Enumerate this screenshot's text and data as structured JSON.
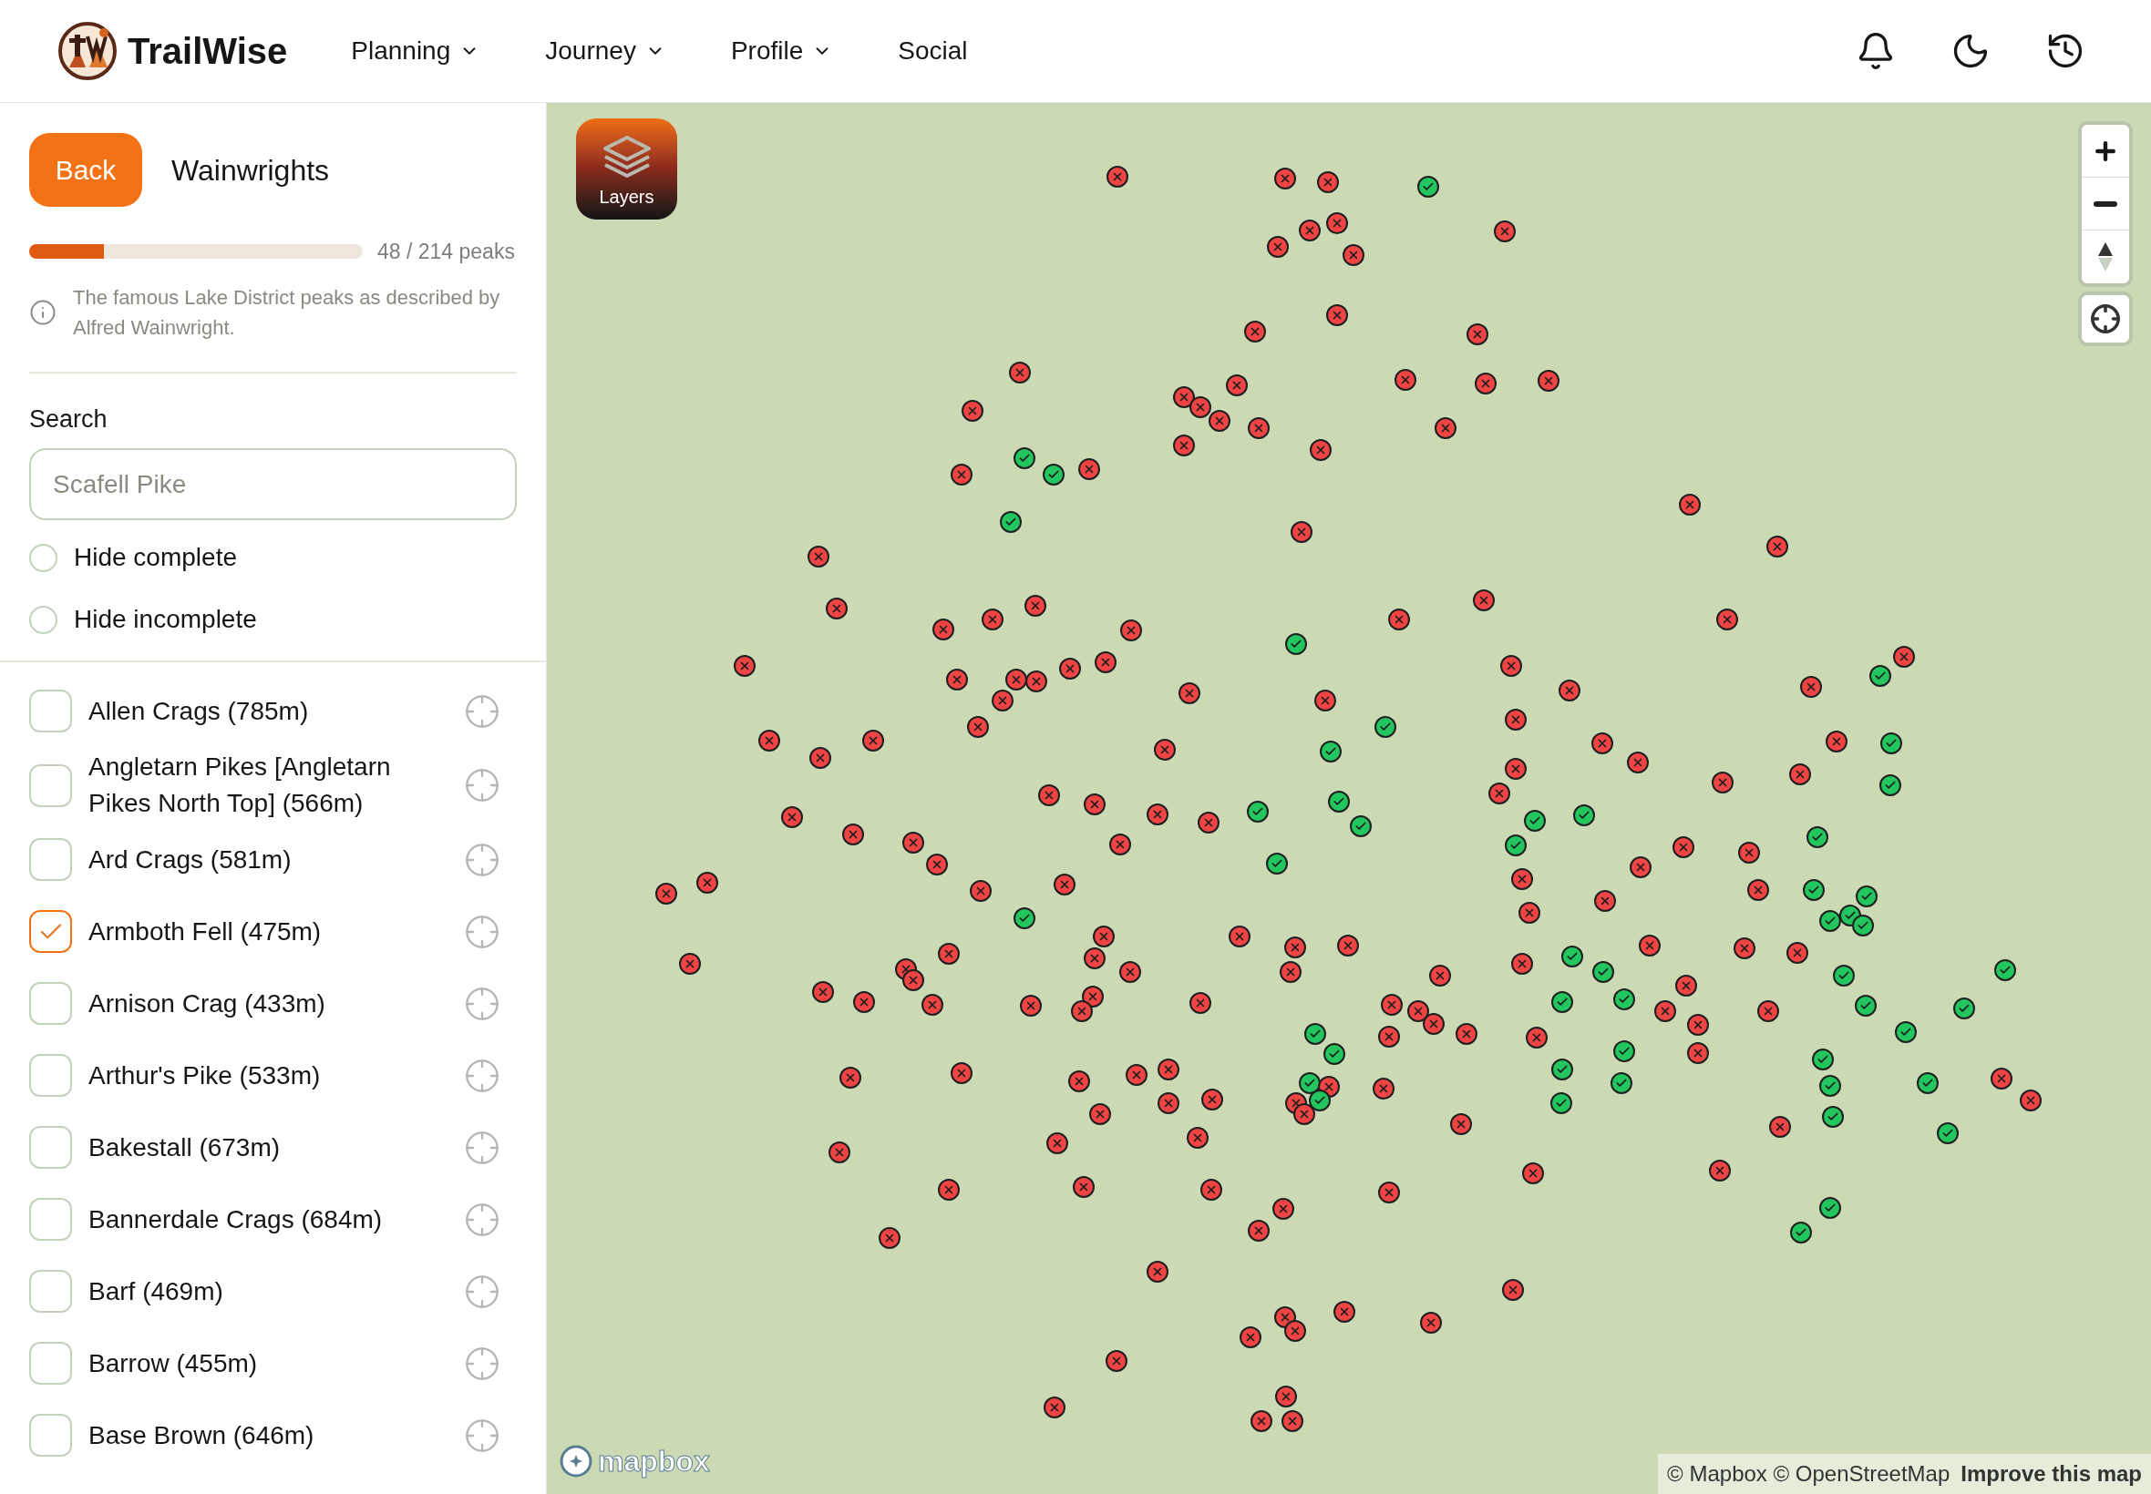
{
  "header": {
    "brand": "TrailWise",
    "nav": [
      {
        "label": "Planning",
        "dropdown": true
      },
      {
        "label": "Journey",
        "dropdown": true
      },
      {
        "label": "Profile",
        "dropdown": true
      },
      {
        "label": "Social",
        "dropdown": false
      }
    ]
  },
  "sidebar": {
    "back_button": "Back",
    "title": "Wainwrights",
    "progress": {
      "level": 0.224,
      "reading": "48 / 214 peaks"
    },
    "description": "The famous Lake District peaks as described by Alfred Wainwright.",
    "search": {
      "label": "Search",
      "placeholder": "Scafell Pike"
    },
    "filters": [
      {
        "label": "Hide complete",
        "selected": false
      },
      {
        "label": "Hide incomplete",
        "selected": false
      }
    ],
    "peaks": [
      {
        "label": "Allen Crags (785m)",
        "checked": false
      },
      {
        "label": "Angletarn Pikes [Angletarn Pikes North Top] (566m)",
        "checked": false
      },
      {
        "label": "Ard Crags (581m)",
        "checked": false
      },
      {
        "label": "Armboth Fell (475m)",
        "checked": true
      },
      {
        "label": "Arnison Crag (433m)",
        "checked": false
      },
      {
        "label": "Arthur's Pike (533m)",
        "checked": false
      },
      {
        "label": "Bakestall (673m)",
        "checked": false
      },
      {
        "label": "Bannerdale Crags (684m)",
        "checked": false
      },
      {
        "label": "Barf (469m)",
        "checked": false
      },
      {
        "label": "Barrow (455m)",
        "checked": false
      },
      {
        "label": "Base Brown (646m)",
        "checked": false
      }
    ]
  },
  "map": {
    "layers_button": "Layers",
    "logo": "mapbox",
    "attribution": "© Mapbox © OpenStreetMap",
    "improve_link": "Improve this map",
    "markers": [
      {
        "complete": false
      },
      {
        "complete": false
      },
      {
        "complete": false
      },
      {
        "complete": true
      },
      {
        "complete": false
      },
      {
        "complete": false
      },
      {
        "complete": false
      },
      {
        "complete": false
      },
      {
        "complete": false
      },
      {
        "complete": false
      },
      {
        "complete": false
      },
      {
        "complete": false
      },
      {
        "complete": false
      },
      {
        "complete": false
      },
      {
        "complete": false
      },
      {
        "complete": false
      },
      {
        "complete": false
      },
      {
        "complete": false
      },
      {
        "complete": false
      },
      {
        "complete": false
      },
      {
        "complete": false
      },
      {
        "complete": false
      },
      {
        "complete": false
      },
      {
        "complete": false
      },
      {
        "complete": false
      },
      {
        "complete": true
      },
      {
        "complete": true
      },
      {
        "complete": false
      },
      {
        "complete": false
      },
      {
        "complete": true
      },
      {
        "complete": false
      },
      {
        "complete": false
      },
      {
        "complete": false
      },
      {
        "complete": false
      },
      {
        "complete": false
      },
      {
        "complete": false
      },
      {
        "complete": false
      },
      {
        "complete": false
      },
      {
        "complete": false
      },
      {
        "complete": true
      },
      {
        "complete": false
      },
      {
        "complete": false
      },
      {
        "complete": false
      },
      {
        "complete": false
      },
      {
        "complete": true
      },
      {
        "complete": false
      },
      {
        "complete": false
      },
      {
        "complete": false
      },
      {
        "complete": false
      },
      {
        "complete": false
      },
      {
        "complete": false
      },
      {
        "complete": false
      },
      {
        "complete": false
      },
      {
        "complete": false
      },
      {
        "complete": false
      },
      {
        "complete": false
      },
      {
        "complete": false
      },
      {
        "complete": true
      },
      {
        "complete": false
      },
      {
        "complete": false
      },
      {
        "complete": false
      },
      {
        "complete": false
      },
      {
        "complete": false
      },
      {
        "complete": false
      },
      {
        "complete": true
      },
      {
        "complete": false
      },
      {
        "complete": false
      },
      {
        "complete": true
      },
      {
        "complete": false
      },
      {
        "complete": false
      },
      {
        "complete": false
      },
      {
        "complete": false
      },
      {
        "complete": false
      },
      {
        "complete": false
      },
      {
        "complete": false
      },
      {
        "complete": true
      },
      {
        "complete": true
      },
      {
        "complete": true
      },
      {
        "complete": true
      },
      {
        "complete": true
      },
      {
        "complete": true
      },
      {
        "complete": false
      },
      {
        "complete": false
      },
      {
        "complete": true
      },
      {
        "complete": false
      },
      {
        "complete": false
      },
      {
        "complete": false
      },
      {
        "complete": false
      },
      {
        "complete": false
      },
      {
        "complete": false
      },
      {
        "complete": false
      },
      {
        "complete": false
      },
      {
        "complete": true
      },
      {
        "complete": true
      },
      {
        "complete": false
      },
      {
        "complete": false
      },
      {
        "complete": false
      },
      {
        "complete": false
      },
      {
        "complete": false
      },
      {
        "complete": false
      },
      {
        "complete": false
      },
      {
        "complete": false
      },
      {
        "complete": true
      },
      {
        "complete": true
      },
      {
        "complete": true
      },
      {
        "complete": true
      },
      {
        "complete": true
      },
      {
        "complete": true
      },
      {
        "complete": false
      },
      {
        "complete": false
      },
      {
        "complete": false
      },
      {
        "complete": false
      },
      {
        "complete": false
      },
      {
        "complete": false
      },
      {
        "complete": false
      },
      {
        "complete": false
      },
      {
        "complete": false
      },
      {
        "complete": false
      },
      {
        "complete": false
      },
      {
        "complete": true
      },
      {
        "complete": true
      },
      {
        "complete": false
      },
      {
        "complete": false
      },
      {
        "complete": false
      },
      {
        "complete": false
      },
      {
        "complete": true
      },
      {
        "complete": true
      },
      {
        "complete": false
      },
      {
        "complete": false
      },
      {
        "complete": false
      },
      {
        "complete": false
      },
      {
        "complete": false
      },
      {
        "complete": false
      },
      {
        "complete": false
      },
      {
        "complete": false
      },
      {
        "complete": false
      },
      {
        "complete": false
      },
      {
        "complete": false
      },
      {
        "complete": true
      },
      {
        "complete": true
      },
      {
        "complete": false
      },
      {
        "complete": false
      },
      {
        "complete": false
      },
      {
        "complete": true
      },
      {
        "complete": true
      },
      {
        "complete": false
      },
      {
        "complete": false
      },
      {
        "complete": false
      },
      {
        "complete": false
      },
      {
        "complete": true
      },
      {
        "complete": true
      },
      {
        "complete": false
      },
      {
        "complete": true
      },
      {
        "complete": true
      },
      {
        "complete": true
      },
      {
        "complete": false
      },
      {
        "complete": false
      },
      {
        "complete": false
      },
      {
        "complete": false
      },
      {
        "complete": false
      },
      {
        "complete": true
      },
      {
        "complete": true
      },
      {
        "complete": true
      },
      {
        "complete": true
      },
      {
        "complete": false
      },
      {
        "complete": false
      },
      {
        "complete": true
      },
      {
        "complete": false
      },
      {
        "complete": true
      },
      {
        "complete": false
      },
      {
        "complete": false
      },
      {
        "complete": false
      },
      {
        "complete": false
      },
      {
        "complete": false
      },
      {
        "complete": false
      },
      {
        "complete": false
      },
      {
        "complete": false
      },
      {
        "complete": false
      },
      {
        "complete": true
      },
      {
        "complete": true
      },
      {
        "complete": false
      },
      {
        "complete": true
      },
      {
        "complete": false
      },
      {
        "complete": false
      },
      {
        "complete": false
      },
      {
        "complete": false
      },
      {
        "complete": false
      },
      {
        "complete": false
      },
      {
        "complete": false
      },
      {
        "complete": false
      },
      {
        "complete": false
      },
      {
        "complete": true
      },
      {
        "complete": true
      },
      {
        "complete": false
      },
      {
        "complete": false
      },
      {
        "complete": false
      },
      {
        "complete": false
      },
      {
        "complete": false
      },
      {
        "complete": false
      },
      {
        "complete": false
      },
      {
        "complete": false
      },
      {
        "complete": false
      },
      {
        "complete": false
      },
      {
        "complete": false
      },
      {
        "complete": false
      },
      {
        "complete": false
      }
    ]
  }
}
